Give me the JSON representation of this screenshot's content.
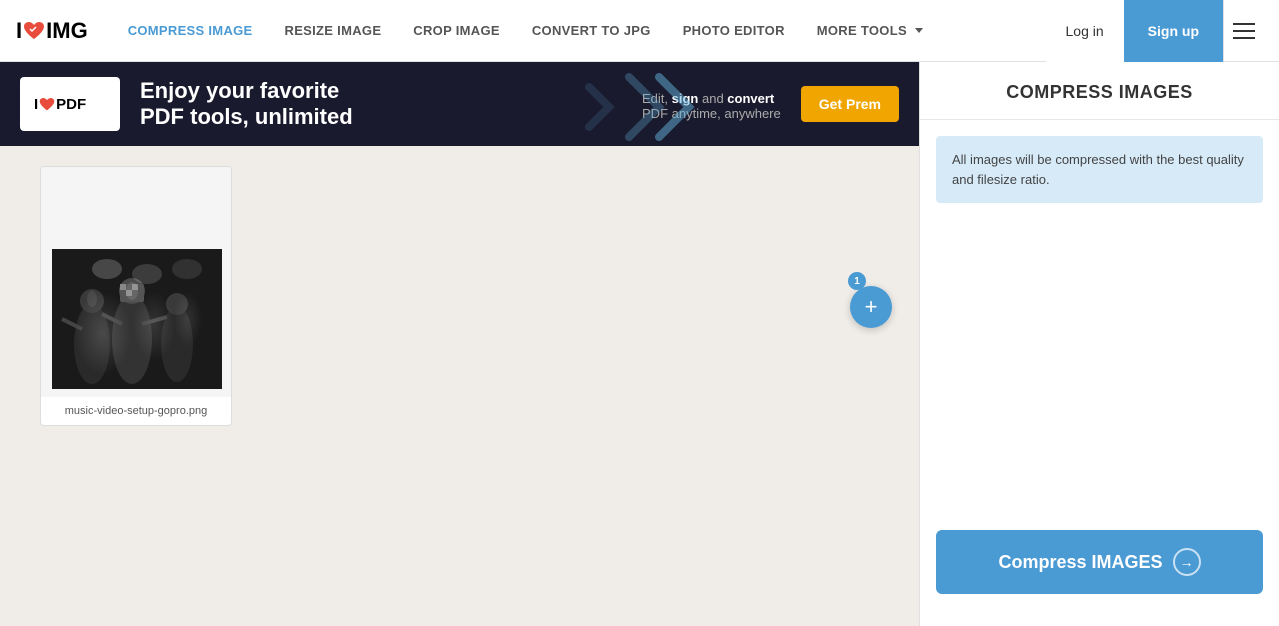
{
  "header": {
    "logo_i": "I",
    "logo_heart": "♥",
    "logo_img": "IMG",
    "nav": [
      {
        "label": "COMPRESS IMAGE",
        "id": "compress",
        "active": true
      },
      {
        "label": "RESIZE IMAGE",
        "id": "resize",
        "active": false
      },
      {
        "label": "CROP IMAGE",
        "id": "crop",
        "active": false
      },
      {
        "label": "CONVERT TO JPG",
        "id": "convert",
        "active": false
      },
      {
        "label": "PHOTO EDITOR",
        "id": "photo",
        "active": false
      },
      {
        "label": "MORE TOOLS",
        "id": "more",
        "active": false,
        "has_dropdown": true
      }
    ],
    "login_label": "Log in",
    "signup_label": "Sign up"
  },
  "ad": {
    "logo_text": "I❤PDF",
    "title": "Enjoy your favorite\nPDF tools, unlimited",
    "subtitle_pre": "Edit, ",
    "subtitle_sign": "sign",
    "subtitle_mid": " and ",
    "subtitle_convert": "convert",
    "subtitle_post": "\nPDF anytime, anywhere",
    "cta": "Get Prem"
  },
  "canvas": {
    "image_filename": "music-video-setup-gopro.png",
    "add_badge": "1"
  },
  "sidebar": {
    "title": "COMPRESS IMAGES",
    "info_text": "All images will be compressed with the best quality and filesize ratio.",
    "compress_btn": "Compress IMAGES"
  }
}
